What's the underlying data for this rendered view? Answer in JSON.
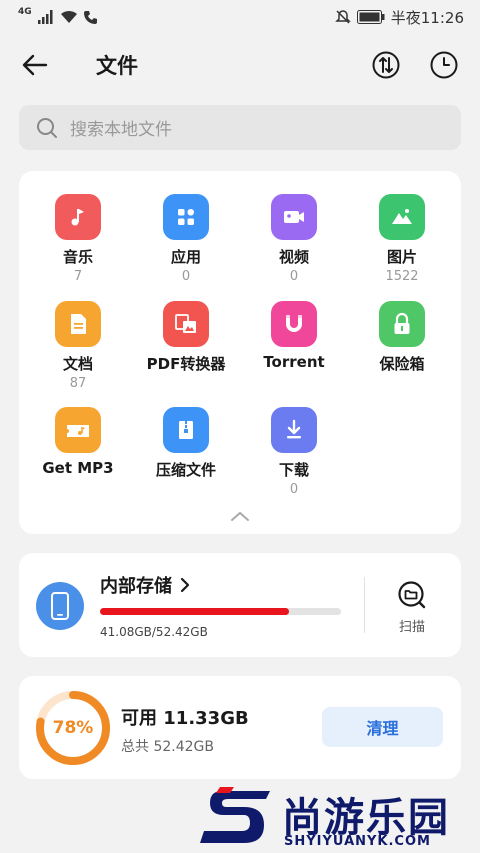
{
  "status_bar": {
    "network": "4G",
    "time": "半夜11:26"
  },
  "header": {
    "title": "文件"
  },
  "search": {
    "placeholder": "搜索本地文件"
  },
  "categories": [
    {
      "label": "音乐",
      "count": "7",
      "icon": "music-icon",
      "color": "#f25b5b"
    },
    {
      "label": "应用",
      "count": "0",
      "icon": "apps-icon",
      "color": "#3d94f6"
    },
    {
      "label": "视频",
      "count": "0",
      "icon": "video-icon",
      "color": "#9a6bf2"
    },
    {
      "label": "图片",
      "count": "1522",
      "icon": "image-icon",
      "color": "#3cc46e"
    },
    {
      "label": "文档",
      "count": "87",
      "icon": "document-icon",
      "color": "#f6a630"
    },
    {
      "label": "PDF转换器",
      "count": "",
      "icon": "pdf-converter-icon",
      "color": "#f2544f"
    },
    {
      "label": "Torrent",
      "count": "",
      "icon": "torrent-magnet-icon",
      "color": "#f0479a"
    },
    {
      "label": "保险箱",
      "count": "",
      "icon": "lock-icon",
      "color": "#4fc766"
    },
    {
      "label": "Get MP3",
      "count": "",
      "icon": "get-mp3-icon",
      "color": "#f6a630"
    },
    {
      "label": "压缩文件",
      "count": "",
      "icon": "zip-icon",
      "color": "#3d94f6"
    },
    {
      "label": "下载",
      "count": "0",
      "icon": "download-icon",
      "color": "#6a7cf0"
    }
  ],
  "storage": {
    "title": "内部存储",
    "used_fraction": 0.784,
    "size_text": "41.08GB/52.42GB",
    "scan_label": "扫描",
    "bar_color": "#e8141e"
  },
  "available": {
    "percent_text": "78%",
    "percent": 78,
    "title": "可用 11.33GB",
    "total": "总共 52.42GB",
    "clean_label": "清理",
    "ring_color": "#f08a24"
  },
  "watermark": {
    "cn": "尚游乐园",
    "en": "SHYIYUANYK.COM"
  }
}
